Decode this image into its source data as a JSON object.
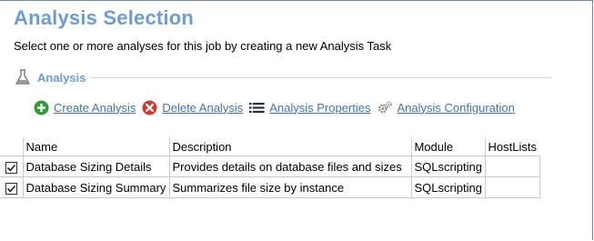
{
  "header": {
    "title": "Analysis Selection",
    "subtitle": "Select one or more analyses for this job by creating a new Analysis Task"
  },
  "group": {
    "label": "Analysis",
    "icon": "flask-icon"
  },
  "toolbar": {
    "create_label": "Create Analysis",
    "delete_label": "Delete Analysis",
    "properties_label": "Analysis Properties",
    "configuration_label": "Analysis Configuration",
    "colors": {
      "create": "#2e9e3a",
      "delete": "#d9342b",
      "link": "#3f73b8"
    }
  },
  "table": {
    "columns": [
      "Name",
      "Description",
      "Module",
      "HostLists"
    ],
    "rows": [
      {
        "checked": true,
        "name": "Database Sizing Details",
        "description": "Provides details on database files and sizes",
        "module": "SQLscripting",
        "hostlists": ""
      },
      {
        "checked": true,
        "name": "Database Sizing Summary",
        "description": "Summarizes file size by instance",
        "module": "SQLscripting",
        "hostlists": ""
      }
    ]
  }
}
